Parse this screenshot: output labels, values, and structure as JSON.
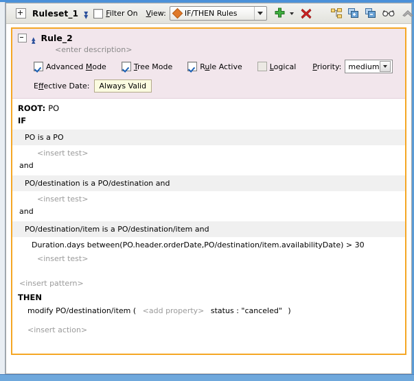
{
  "toolbar": {
    "expand_icon": "plus-box-icon",
    "ruleset_name": "Ruleset_1",
    "collapse_all_icon": "double-chevron-down-icon",
    "filter_label": "Filter On",
    "filter_checked": false,
    "view_label": "View:",
    "view_value": "IF/THEN Rules",
    "view_icon": "orange-diamond-icon",
    "add_label": "add-icon",
    "add_menu_label": "add-dropdown-arrow-icon",
    "delete_label": "delete-x-icon",
    "tree_icon": "tree-structure-icon",
    "group_add_icon": "add-to-group-icon",
    "group_remove_icon": "remove-from-group-icon",
    "glasses_icon": "view-glasses-icon",
    "move_up_icon": "move-up-chevron-icon",
    "move_down_icon": "move-down-chevron-icon"
  },
  "rule": {
    "collapse_icon": "minus-box-icon",
    "toggle_icon": "double-chevron-up-icon",
    "name": "Rule_2",
    "description": "<enter description>",
    "options": [
      {
        "label": "Advanced Mode",
        "accel": "M",
        "checked": true
      },
      {
        "label": "Tree Mode",
        "accel": "T",
        "checked": true
      },
      {
        "label": "Rule Active",
        "accel": "u",
        "checked": true
      },
      {
        "label": "Logical",
        "accel": "L",
        "checked": false
      }
    ],
    "priority_label": "Priority:",
    "priority_value": "medium",
    "effective_date_label": "Effective Date:",
    "effective_date_value": "Always Valid"
  },
  "body": {
    "root_label": "ROOT:",
    "root_value": "PO",
    "if_label": "IF",
    "then_label": "THEN",
    "patterns": [
      {
        "text": "PO is a PO",
        "test": "<insert test>",
        "connector": "and",
        "expression": null
      },
      {
        "text": "PO/destination is a PO/destination  and",
        "test": "<insert test>",
        "connector": "and",
        "expression": null
      },
      {
        "text": "PO/destination/item is a PO/destination/item  and",
        "expression": "Duration.days between(PO.header.orderDate,PO/destination/item.availabilityDate)  >  30",
        "test": "<insert test>",
        "connector": null
      }
    ],
    "insert_pattern": "<insert pattern>",
    "action_prefix": "modify PO/destination/item (",
    "action_add_property": "<add property>",
    "action_assignment": "status : \"canceled\"",
    "action_suffix": ")",
    "insert_action": "<insert action>"
  },
  "colors": {
    "rule_border": "#f5a623",
    "card_header_bg": "#f2e6ec",
    "pattern_bg": "#f0f0f0",
    "ghost_text": "#9a9a9a",
    "window_bg": "#6fa8dc"
  }
}
